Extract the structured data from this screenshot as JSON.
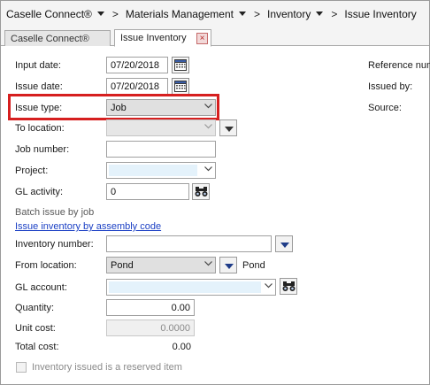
{
  "breadcrumb": {
    "items": [
      "Caselle Connect®",
      "Materials Management",
      "Inventory",
      "Issue Inventory"
    ],
    "separator": ">"
  },
  "tabs": {
    "inactive_label": "Caselle Connect®",
    "active_label": "Issue Inventory",
    "close_glyph": "×"
  },
  "form": {
    "input_date": {
      "label": "Input date:",
      "value": "07/20/2018"
    },
    "issue_date": {
      "label": "Issue date:",
      "value": "07/20/2018"
    },
    "issue_type": {
      "label": "Issue type:",
      "value": "Job"
    },
    "to_location": {
      "label": "To location:",
      "value": ""
    },
    "job_number": {
      "label": "Job number:",
      "value": ""
    },
    "project": {
      "label": "Project:",
      "value": ""
    },
    "gl_activity": {
      "label": "GL activity:",
      "value": "0"
    },
    "batch_header": "Batch issue by job",
    "assembly_link": "Issue inventory by assembly code",
    "inventory_number": {
      "label": "Inventory number:",
      "value": ""
    },
    "from_location": {
      "label": "From location:",
      "value": "Pond",
      "description": "Pond"
    },
    "gl_account": {
      "label": "GL account:",
      "value": ""
    },
    "quantity": {
      "label": "Quantity:",
      "value": "0.00"
    },
    "unit_cost": {
      "label": "Unit cost:",
      "value": "0.0000"
    },
    "total_cost": {
      "label": "Total cost:",
      "value": "0.00"
    },
    "reserved_checkbox": {
      "label": "Inventory issued is a reserved item",
      "checked": false
    }
  },
  "right_panel": {
    "reference_label": "Reference num",
    "issued_by_label": "Issued by:",
    "source_label": "Source:"
  },
  "colors": {
    "highlight": "#d61f1f",
    "link": "#1a3fc4",
    "dropdown_arrow": "#1f3c88",
    "blue_field": "#e8f4fc"
  },
  "icons": {
    "calendar": "calendar-icon",
    "binoculars": "binoculars-icon",
    "dropdown": "chevron-down-icon",
    "lookup": "triangle-down-icon",
    "close": "close-icon"
  }
}
